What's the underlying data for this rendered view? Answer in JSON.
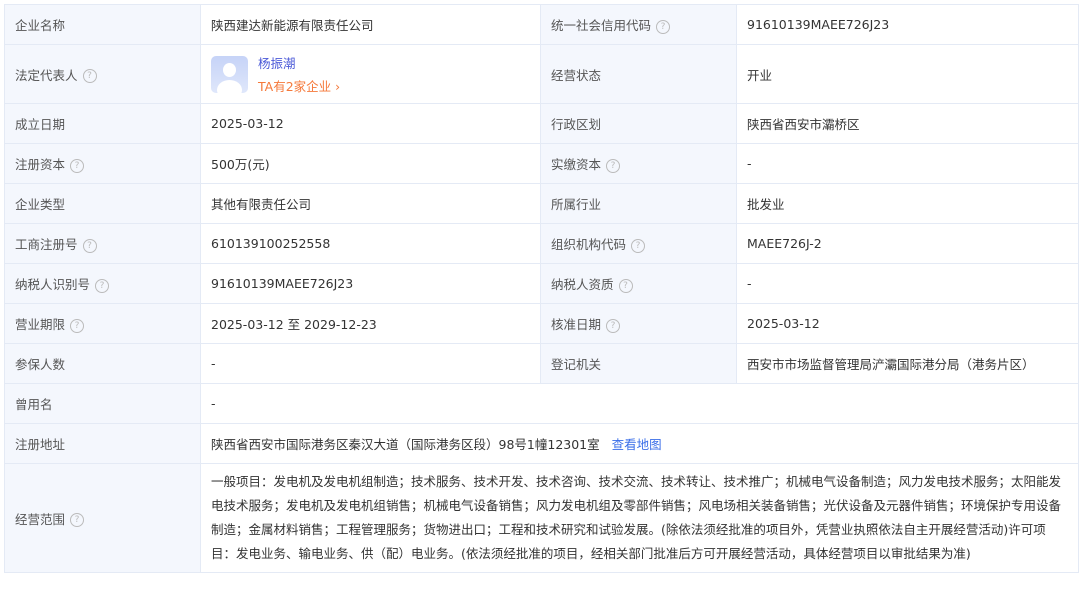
{
  "rows": [
    {
      "l1": "企业名称",
      "v1": "陕西建达新能源有限责任公司",
      "l2": "统一社会信用代码",
      "v2": "91610139MAEE726J23",
      "h1": false,
      "h2": true
    },
    {
      "l2": "经营状态",
      "v2": "开业"
    },
    {
      "l1": "成立日期",
      "v1": "2025-03-12",
      "l2": "行政区划",
      "v2": "陕西省西安市灞桥区",
      "h1": false,
      "h2": false
    },
    {
      "l1": "注册资本",
      "v1": "500万(元)",
      "l2": "实缴资本",
      "v2": "-",
      "h1": true,
      "h2": true
    },
    {
      "l1": "企业类型",
      "v1": "其他有限责任公司",
      "l2": "所属行业",
      "v2": "批发业",
      "h1": false,
      "h2": false
    },
    {
      "l1": "工商注册号",
      "v1": "610139100252558",
      "l2": "组织机构代码",
      "v2": "MAEE726J-2",
      "h1": true,
      "h2": true
    },
    {
      "l1": "纳税人识别号",
      "v1": "91610139MAEE726J23",
      "l2": "纳税人资质",
      "v2": "-",
      "h1": true,
      "h2": true
    },
    {
      "l1": "营业期限",
      "v1": "2025-03-12 至 2029-12-23",
      "l2": "核准日期",
      "v2": "2025-03-12",
      "h1": true,
      "h2": true
    },
    {
      "l1": "参保人数",
      "v1": "-",
      "l2": "登记机关",
      "v2": "西安市市场监督管理局浐灞国际港分局（港务片区）",
      "h1": false,
      "h2": false
    }
  ],
  "legal_rep": {
    "label": "法定代表人",
    "name": "杨振潮",
    "companies": "TA有2家企业 ›"
  },
  "former_name": {
    "label": "曾用名",
    "value": "-"
  },
  "address": {
    "label": "注册地址",
    "value": "陕西省西安市国际港务区秦汉大道（国际港务区段）98号1幢12301室",
    "map_link": "查看地图"
  },
  "scope": {
    "label": "经营范围",
    "value": "一般项目：发电机及发电机组制造；技术服务、技术开发、技术咨询、技术交流、技术转让、技术推广；机械电气设备制造；风力发电技术服务；太阳能发电技术服务；发电机及发电机组销售；机械电气设备销售；风力发电机组及零部件销售；风电场相关装备销售；光伏设备及元器件销售；环境保护专用设备制造；金属材料销售；工程管理服务；货物进出口；工程和技术研究和试验发展。(除依法须经批准的项目外，凭营业执照依法自主开展经营活动)许可项目：发电业务、输电业务、供（配）电业务。(依法须经批准的项目，经相关部门批准后方可开展经营活动，具体经营项目以审批结果为准)"
  },
  "help_glyph": "?"
}
